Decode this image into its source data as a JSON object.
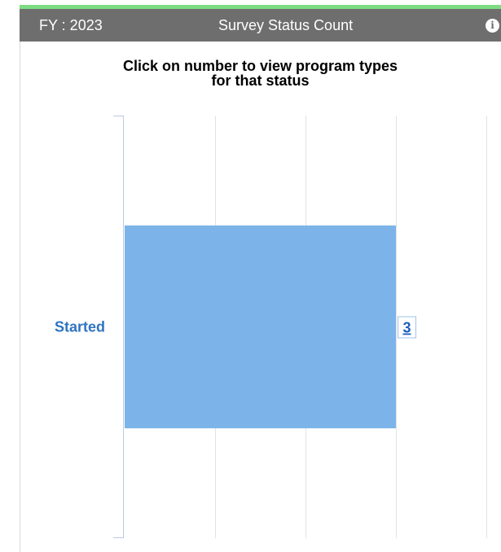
{
  "header": {
    "fy_label": "FY : 2023",
    "title": "Survey Status Count",
    "info_icon": "info-icon"
  },
  "colors": {
    "header_bg": "#6e6e6e",
    "accent": "#7ddc82",
    "bar": "#7cb4ea",
    "label": "#2f74c0"
  },
  "chart_data": {
    "type": "bar",
    "orientation": "horizontal",
    "title": "Click on number to view program types for that status",
    "title_lines": [
      "Click on number to view program types",
      "for that status"
    ],
    "categories": [
      "Started"
    ],
    "values": [
      3
    ],
    "data_labels": [
      "3"
    ],
    "xlim": [
      0,
      4
    ],
    "grid": true
  }
}
